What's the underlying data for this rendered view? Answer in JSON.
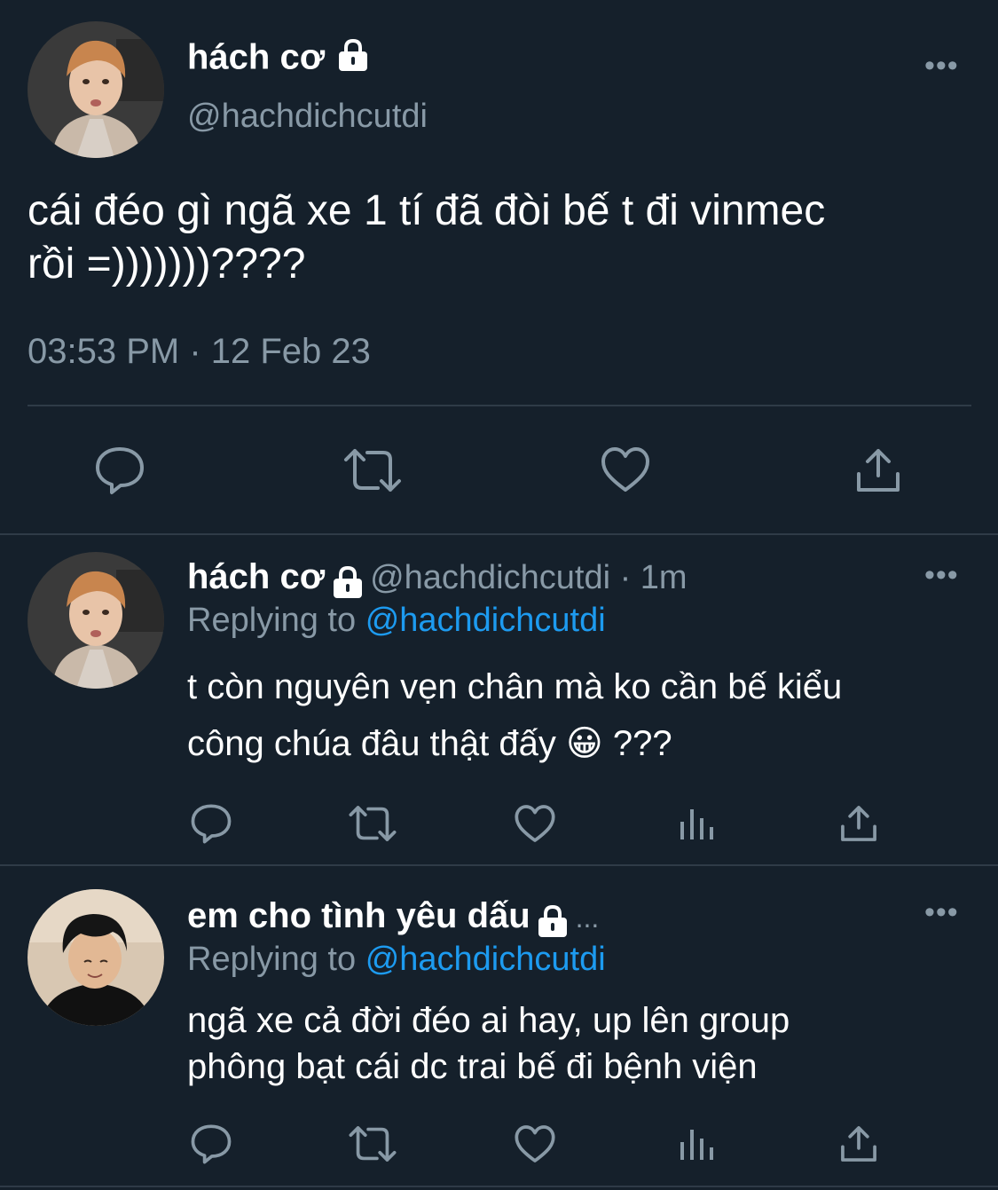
{
  "main_tweet": {
    "display_name": "hách cơ",
    "handle": "@hachdichcutdi",
    "text_line1": "cái đéo gì ngã xe 1 tí đã đòi bế t đi vinmec",
    "text_line2": "rồi =)))))))????",
    "timestamp": "03:53 PM · 12 Feb 23",
    "actions": [
      "reply-icon",
      "retweet-icon",
      "like-icon",
      "share-icon"
    ]
  },
  "replies": [
    {
      "display_name": "hách cơ",
      "handle_time": "@hachdichcutdi · 1m",
      "replying_prefix": "Replying to",
      "replying_handle": "@hachdichcutdi",
      "text_line1": "t còn nguyên vẹn chân mà ko cần bế kiểu",
      "text_line2": "công chúa đâu thật đấy",
      "emoji": "😀",
      "text_suffix": "???",
      "actions": [
        "reply-icon",
        "retweet-icon",
        "like-icon",
        "analytics-icon",
        "share-icon"
      ]
    },
    {
      "display_name": "em cho tình yêu dấu",
      "ellipsis": "...",
      "replying_prefix": "Replying to",
      "replying_handle": "@hachdichcutdi",
      "text_line1": "ngã xe cả đời đéo ai hay, up lên group",
      "text_line2": "phông bạt cái dc trai bế đi bệnh viện",
      "actions": [
        "reply-icon",
        "retweet-icon",
        "like-icon",
        "analytics-icon",
        "share-icon"
      ]
    }
  ],
  "more_label": "•••",
  "colors": {
    "background": "#15202b",
    "text": "#ffffff",
    "muted": "#8899a6",
    "link": "#1d9bf0",
    "divider": "#2f3b47"
  }
}
